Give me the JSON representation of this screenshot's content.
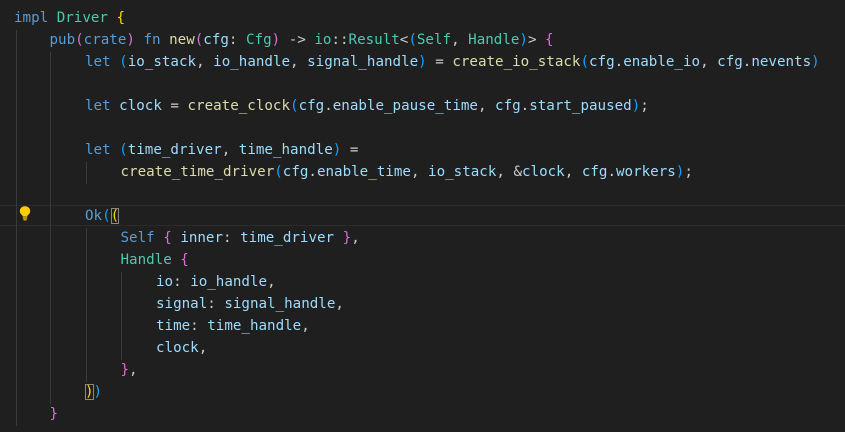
{
  "editor": {
    "language": "rust",
    "colors": {
      "background": "#1f1f1f",
      "keyword": "#569cd6",
      "type": "#4ec9b0",
      "function": "#dcdcaa",
      "variable": "#9cdcfe",
      "bracket_level_1": "#ffd700",
      "bracket_level_2": "#da70d6",
      "bracket_level_3": "#179fff"
    },
    "lightbulb_icon": "lightbulb-icon",
    "lines": [
      {
        "indent": 0,
        "tokens": [
          {
            "text": "impl",
            "c": "kw"
          },
          {
            "text": " ",
            "c": "plain"
          },
          {
            "text": "Driver",
            "c": "type"
          },
          {
            "text": " ",
            "c": "plain"
          },
          {
            "text": "{",
            "c": "b1"
          }
        ]
      },
      {
        "indent": 1,
        "tokens": [
          {
            "text": "pub",
            "c": "kw"
          },
          {
            "text": "(",
            "c": "b2"
          },
          {
            "text": "crate",
            "c": "kw"
          },
          {
            "text": ")",
            "c": "b2"
          },
          {
            "text": " ",
            "c": "plain"
          },
          {
            "text": "fn",
            "c": "kw"
          },
          {
            "text": " ",
            "c": "plain"
          },
          {
            "text": "new",
            "c": "fn"
          },
          {
            "text": "(",
            "c": "b2"
          },
          {
            "text": "cfg",
            "c": "var"
          },
          {
            "text": ": ",
            "c": "plain"
          },
          {
            "text": "Cfg",
            "c": "type"
          },
          {
            "text": ")",
            "c": "b2"
          },
          {
            "text": " -> ",
            "c": "plain"
          },
          {
            "text": "io",
            "c": "type"
          },
          {
            "text": "::",
            "c": "plain"
          },
          {
            "text": "Result",
            "c": "type"
          },
          {
            "text": "<",
            "c": "plain"
          },
          {
            "text": "(",
            "c": "b3"
          },
          {
            "text": "Self",
            "c": "type"
          },
          {
            "text": ", ",
            "c": "plain"
          },
          {
            "text": "Handle",
            "c": "type"
          },
          {
            "text": ")",
            "c": "b3"
          },
          {
            "text": ">",
            "c": "plain"
          },
          {
            "text": " ",
            "c": "plain"
          },
          {
            "text": "{",
            "c": "b2"
          }
        ]
      },
      {
        "indent": 2,
        "tokens": [
          {
            "text": "let",
            "c": "kw"
          },
          {
            "text": " ",
            "c": "plain"
          },
          {
            "text": "(",
            "c": "b3"
          },
          {
            "text": "io_stack",
            "c": "var"
          },
          {
            "text": ", ",
            "c": "plain"
          },
          {
            "text": "io_handle",
            "c": "var"
          },
          {
            "text": ", ",
            "c": "plain"
          },
          {
            "text": "signal_handle",
            "c": "var"
          },
          {
            "text": ")",
            "c": "b3"
          },
          {
            "text": " = ",
            "c": "plain"
          },
          {
            "text": "create_io_stack",
            "c": "fn"
          },
          {
            "text": "(",
            "c": "b3"
          },
          {
            "text": "cfg",
            "c": "var"
          },
          {
            "text": ".",
            "c": "plain"
          },
          {
            "text": "enable_io",
            "c": "var"
          },
          {
            "text": ", ",
            "c": "plain"
          },
          {
            "text": "cfg",
            "c": "var"
          },
          {
            "text": ".",
            "c": "plain"
          },
          {
            "text": "nevents",
            "c": "var"
          },
          {
            "text": ")",
            "c": "b3"
          }
        ]
      },
      {
        "indent": 2,
        "tokens": []
      },
      {
        "indent": 2,
        "tokens": [
          {
            "text": "let",
            "c": "kw"
          },
          {
            "text": " ",
            "c": "plain"
          },
          {
            "text": "clock",
            "c": "var"
          },
          {
            "text": " = ",
            "c": "plain"
          },
          {
            "text": "create_clock",
            "c": "fn"
          },
          {
            "text": "(",
            "c": "b3"
          },
          {
            "text": "cfg",
            "c": "var"
          },
          {
            "text": ".",
            "c": "plain"
          },
          {
            "text": "enable_pause_time",
            "c": "var"
          },
          {
            "text": ", ",
            "c": "plain"
          },
          {
            "text": "cfg",
            "c": "var"
          },
          {
            "text": ".",
            "c": "plain"
          },
          {
            "text": "start_paused",
            "c": "var"
          },
          {
            "text": ")",
            "c": "b3"
          },
          {
            "text": ";",
            "c": "plain"
          }
        ]
      },
      {
        "indent": 2,
        "tokens": []
      },
      {
        "indent": 2,
        "tokens": [
          {
            "text": "let",
            "c": "kw"
          },
          {
            "text": " ",
            "c": "plain"
          },
          {
            "text": "(",
            "c": "b3"
          },
          {
            "text": "time_driver",
            "c": "var"
          },
          {
            "text": ", ",
            "c": "plain"
          },
          {
            "text": "time_handle",
            "c": "var"
          },
          {
            "text": ")",
            "c": "b3"
          },
          {
            "text": " =",
            "c": "plain"
          }
        ]
      },
      {
        "indent": 3,
        "tokens": [
          {
            "text": "create_time_driver",
            "c": "fn"
          },
          {
            "text": "(",
            "c": "b3"
          },
          {
            "text": "cfg",
            "c": "var"
          },
          {
            "text": ".",
            "c": "plain"
          },
          {
            "text": "enable_time",
            "c": "var"
          },
          {
            "text": ", ",
            "c": "plain"
          },
          {
            "text": "io_stack",
            "c": "var"
          },
          {
            "text": ", &",
            "c": "plain"
          },
          {
            "text": "clock",
            "c": "var"
          },
          {
            "text": ", ",
            "c": "plain"
          },
          {
            "text": "cfg",
            "c": "var"
          },
          {
            "text": ".",
            "c": "plain"
          },
          {
            "text": "workers",
            "c": "var"
          },
          {
            "text": ")",
            "c": "b3"
          },
          {
            "text": ";",
            "c": "plain"
          }
        ]
      },
      {
        "indent": 2,
        "tokens": []
      },
      {
        "indent": 2,
        "tokens": [
          {
            "text": "Ok",
            "c": "kw"
          },
          {
            "text": "(",
            "c": "b3"
          },
          {
            "text": "(",
            "c": "b1",
            "m": true
          }
        ]
      },
      {
        "indent": 3,
        "tokens": [
          {
            "text": "Self",
            "c": "kw"
          },
          {
            "text": " ",
            "c": "plain"
          },
          {
            "text": "{",
            "c": "b2"
          },
          {
            "text": " ",
            "c": "plain"
          },
          {
            "text": "inner",
            "c": "var"
          },
          {
            "text": ": ",
            "c": "plain"
          },
          {
            "text": "time_driver",
            "c": "var"
          },
          {
            "text": " ",
            "c": "plain"
          },
          {
            "text": "}",
            "c": "b2"
          },
          {
            "text": ",",
            "c": "plain"
          }
        ]
      },
      {
        "indent": 3,
        "tokens": [
          {
            "text": "Handle",
            "c": "type"
          },
          {
            "text": " ",
            "c": "plain"
          },
          {
            "text": "{",
            "c": "b2"
          }
        ]
      },
      {
        "indent": 4,
        "tokens": [
          {
            "text": "io",
            "c": "var"
          },
          {
            "text": ": ",
            "c": "plain"
          },
          {
            "text": "io_handle",
            "c": "var"
          },
          {
            "text": ",",
            "c": "plain"
          }
        ]
      },
      {
        "indent": 4,
        "tokens": [
          {
            "text": "signal",
            "c": "var"
          },
          {
            "text": ": ",
            "c": "plain"
          },
          {
            "text": "signal_handle",
            "c": "var"
          },
          {
            "text": ",",
            "c": "plain"
          }
        ]
      },
      {
        "indent": 4,
        "tokens": [
          {
            "text": "time",
            "c": "var"
          },
          {
            "text": ": ",
            "c": "plain"
          },
          {
            "text": "time_handle",
            "c": "var"
          },
          {
            "text": ",",
            "c": "plain"
          }
        ]
      },
      {
        "indent": 4,
        "tokens": [
          {
            "text": "clock",
            "c": "var"
          },
          {
            "text": ",",
            "c": "plain"
          }
        ]
      },
      {
        "indent": 3,
        "tokens": [
          {
            "text": "}",
            "c": "b2"
          },
          {
            "text": ",",
            "c": "plain"
          }
        ]
      },
      {
        "indent": 2,
        "tokens": [
          {
            "text": ")",
            "c": "b1",
            "m": true
          },
          {
            "text": ")",
            "c": "b3"
          }
        ]
      },
      {
        "indent": 1,
        "tokens": [
          {
            "text": "}",
            "c": "b2"
          }
        ]
      }
    ]
  }
}
